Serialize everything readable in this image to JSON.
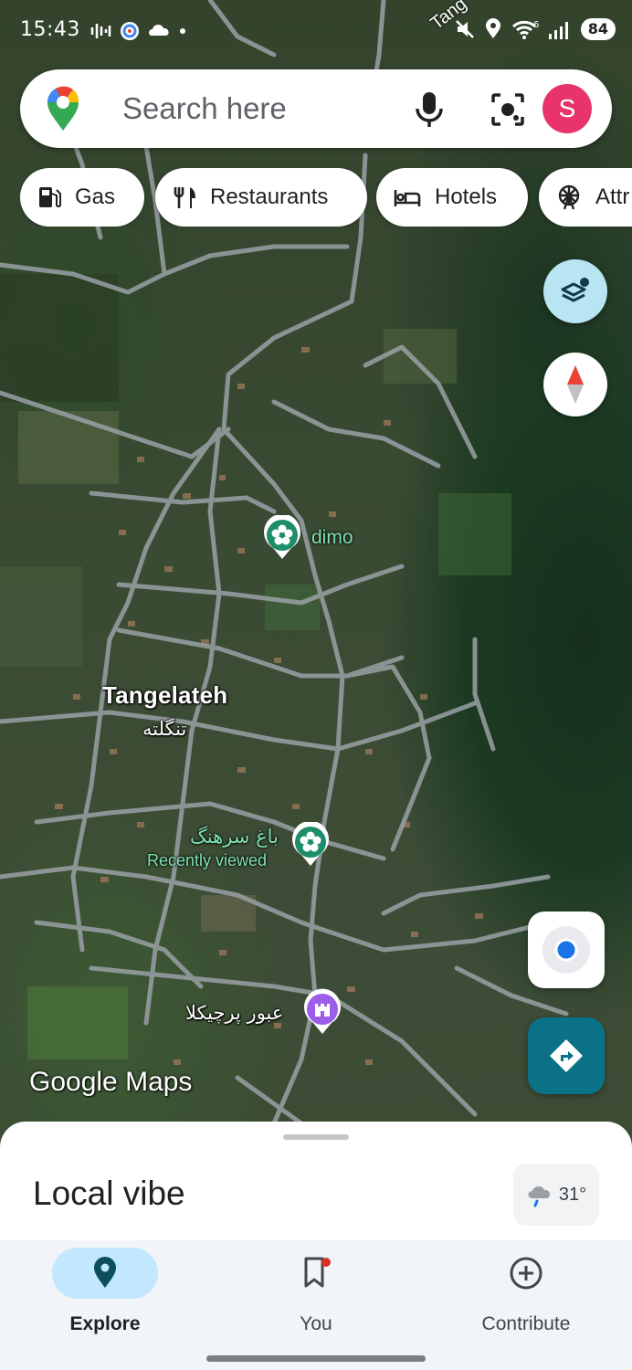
{
  "status_bar": {
    "time": "15:43",
    "battery": "84",
    "wifi_label": "6"
  },
  "search": {
    "placeholder": "Search here",
    "avatar_letter": "S"
  },
  "chips": [
    {
      "label": "Gas",
      "icon": "gas-station-icon"
    },
    {
      "label": "Restaurants",
      "icon": "fork-knife-icon"
    },
    {
      "label": "Hotels",
      "icon": "bed-icon"
    },
    {
      "label": "Attr",
      "icon": "ferris-wheel-icon"
    }
  ],
  "map": {
    "top_road_label": "Tang",
    "place_name": "Tangelateh",
    "place_name_local": "تنگلته",
    "poi_dimo": "dimo",
    "poi_garden": "باغ سرهنگ",
    "poi_garden_subtitle": "Recently viewed",
    "poi_landmark": "عبور پرچیکلا",
    "watermark": "Google Maps",
    "colors": {
      "poi_green": "#1e8e6a",
      "poi_purple": "#9c5ee8",
      "road": "#9aa0a6"
    }
  },
  "sheet": {
    "title": "Local vibe",
    "weather_temp": "31°"
  },
  "nav": {
    "items": [
      {
        "label": "Explore",
        "icon": "pin-icon",
        "active": true
      },
      {
        "label": "You",
        "icon": "bookmark-icon",
        "active": false
      },
      {
        "label": "Contribute",
        "icon": "plus-circle-icon",
        "active": false
      }
    ]
  },
  "accent": "#0b7187"
}
